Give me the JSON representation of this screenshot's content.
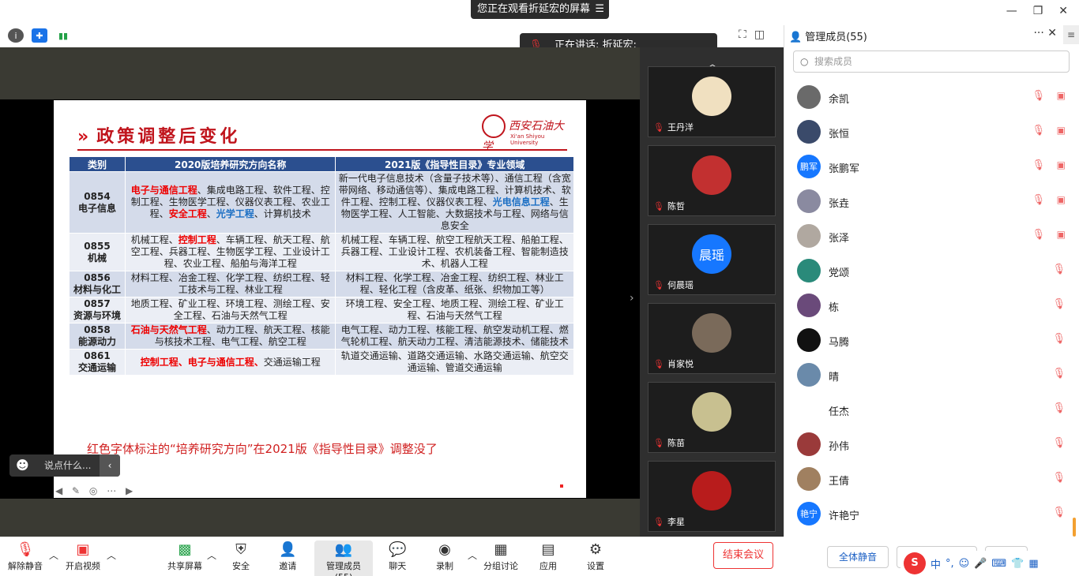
{
  "topbar": {
    "viewing_banner": "您正在观看折延宏的屏幕",
    "speaking_label": "正在讲话: 折延宏;"
  },
  "slide": {
    "title": "政策调整后变化",
    "logo_cn": "西安石油大学",
    "logo_en": "Xi'an Shiyou University",
    "headers": [
      "类别",
      "2020版培养研究方向名称",
      "2021版《指导性目录》专业领域"
    ],
    "rows": [
      {
        "code": "0854",
        "name": "电子信息",
        "old": [
          {
            "t": "电子与通信工程",
            "c": "red"
          },
          {
            "t": "、集成电路工程、软件工程、控制工程、生物医学工程、仪器仪表工程、农业工程、",
            "c": ""
          },
          {
            "t": "安全工程",
            "c": "red"
          },
          {
            "t": "、",
            "c": ""
          },
          {
            "t": "光学工程",
            "c": "blue"
          },
          {
            "t": "、计算机技术",
            "c": ""
          }
        ],
        "new": [
          {
            "t": "新一代电子信息技术（含量子技术等）、通信工程（含宽带网络、移动通信等）、集成电路工程、计算机技术、软件工程、控制工程、仪器仪表工程、",
            "c": ""
          },
          {
            "t": "光电信息工程",
            "c": "blue"
          },
          {
            "t": "、生物医学工程、人工智能、大数据技术与工程、网络与信息安全",
            "c": ""
          }
        ]
      },
      {
        "code": "0855",
        "name": "机械",
        "old": [
          {
            "t": "机械工程、",
            "c": ""
          },
          {
            "t": "控制工程",
            "c": "red"
          },
          {
            "t": "、车辆工程、航天工程、航空工程、兵器工程、生物医学工程、工业设计工程、农业工程、船舶与海洋工程",
            "c": ""
          }
        ],
        "new": [
          {
            "t": "机械工程、车辆工程、航空工程航天工程、船舶工程、兵器工程、工业设计工程、农机装备工程、智能制造技术、机器人工程",
            "c": ""
          }
        ]
      },
      {
        "code": "0856",
        "name": "材料与化工",
        "old": [
          {
            "t": "材料工程、冶金工程、化学工程、纺织工程、轻工技术与工程、林业工程",
            "c": ""
          }
        ],
        "new": [
          {
            "t": "材料工程、化学工程、冶金工程、纺织工程、林业工程、轻化工程（含皮革、纸张、织物加工等）",
            "c": ""
          }
        ]
      },
      {
        "code": "0857",
        "name": "资源与环境",
        "old": [
          {
            "t": "地质工程、矿业工程、环境工程、测绘工程、安全工程、石油与天然气工程",
            "c": ""
          }
        ],
        "new": [
          {
            "t": "环境工程、安全工程、地质工程、测绘工程、矿业工程、石油与天然气工程",
            "c": ""
          }
        ]
      },
      {
        "code": "0858",
        "name": "能源动力",
        "old": [
          {
            "t": "石油与天然气工程",
            "c": "red"
          },
          {
            "t": "、动力工程、航天工程、核能与核技术工程、电气工程、航空工程",
            "c": ""
          }
        ],
        "new": [
          {
            "t": "电气工程、动力工程、核能工程、航空发动机工程、燃气轮机工程、航天动力工程、清洁能源技术、储能技术",
            "c": ""
          }
        ]
      },
      {
        "code": "0861",
        "name": "交通运输",
        "old": [
          {
            "t": "控制工程、电子与通信工程、",
            "c": "red"
          },
          {
            "t": "交通运输工程",
            "c": ""
          }
        ],
        "new": [
          {
            "t": "轨道交通运输、道路交通运输、水路交通运输、航空交通运输、管道交通运输",
            "c": ""
          }
        ]
      }
    ],
    "note": "红色字体标注的“培养研究方向”在2021版《指导性目录》调整没了"
  },
  "chat_input_placeholder": "说点什么...",
  "video_tiles": [
    {
      "name": "王丹洋",
      "avatar": "",
      "color": "#f0e0c0"
    },
    {
      "name": "陈哲",
      "avatar": "",
      "color": "#c23030"
    },
    {
      "name": "何晨瑶",
      "avatar": "晨瑶",
      "color": "#1677ff"
    },
    {
      "name": "肖家悦",
      "avatar": "",
      "color": "#7a6a5a"
    },
    {
      "name": "陈苗",
      "avatar": "",
      "color": "#c8c090"
    },
    {
      "name": "李星",
      "avatar": "",
      "color": "#b81c1c"
    }
  ],
  "panel": {
    "title": "管理成员(55)",
    "search_placeholder": "搜索成员",
    "members": [
      {
        "name": "余凯",
        "avatar": "",
        "color": "#6a6a6a",
        "cam_off": true
      },
      {
        "name": "张恒",
        "avatar": "",
        "color": "#3a4a6a",
        "cam_off": true
      },
      {
        "name": "张鹏军",
        "avatar": "鹏军",
        "color": "#1677ff",
        "cam_off": true
      },
      {
        "name": "张垚",
        "avatar": "",
        "color": "#8a8aa0",
        "cam_off": true
      },
      {
        "name": "张泽",
        "avatar": "",
        "color": "#b0a8a0",
        "cam_off": true
      },
      {
        "name": "党颂",
        "avatar": "",
        "color": "#2a8a7a",
        "cam_off": false
      },
      {
        "name": "栋",
        "avatar": "",
        "color": "#6a4a7a",
        "cam_off": false
      },
      {
        "name": "马腾",
        "avatar": "",
        "color": "#111111",
        "cam_off": false
      },
      {
        "name": "晴",
        "avatar": "",
        "color": "#6a8aaa",
        "cam_off": false
      },
      {
        "name": "任杰",
        "avatar": "",
        "color": "#ffffff",
        "cam_off": false
      },
      {
        "name": "孙伟",
        "avatar": "",
        "color": "#9a3a3a",
        "cam_off": false
      },
      {
        "name": "王倩",
        "avatar": "",
        "color": "#a08060",
        "cam_off": false
      },
      {
        "name": "许艳宁",
        "avatar": "艳宁",
        "color": "#1677ff",
        "cam_off": false
      }
    ],
    "buttons": [
      "全体静音",
      "解除全体静音",
      "更多"
    ]
  },
  "toolbar": {
    "unmute": "解除静音",
    "video": "开启视频",
    "share": "共享屏幕",
    "security": "安全",
    "invite": "邀请",
    "members": "管理成员(55)",
    "chat": "聊天",
    "record": "录制",
    "breakout": "分组讨论",
    "apps": "应用",
    "settings": "设置",
    "end": "结束会议"
  },
  "ime": [
    "S",
    "中",
    "°,",
    "☺",
    "🎤",
    "⌨",
    "👕",
    "▦"
  ]
}
